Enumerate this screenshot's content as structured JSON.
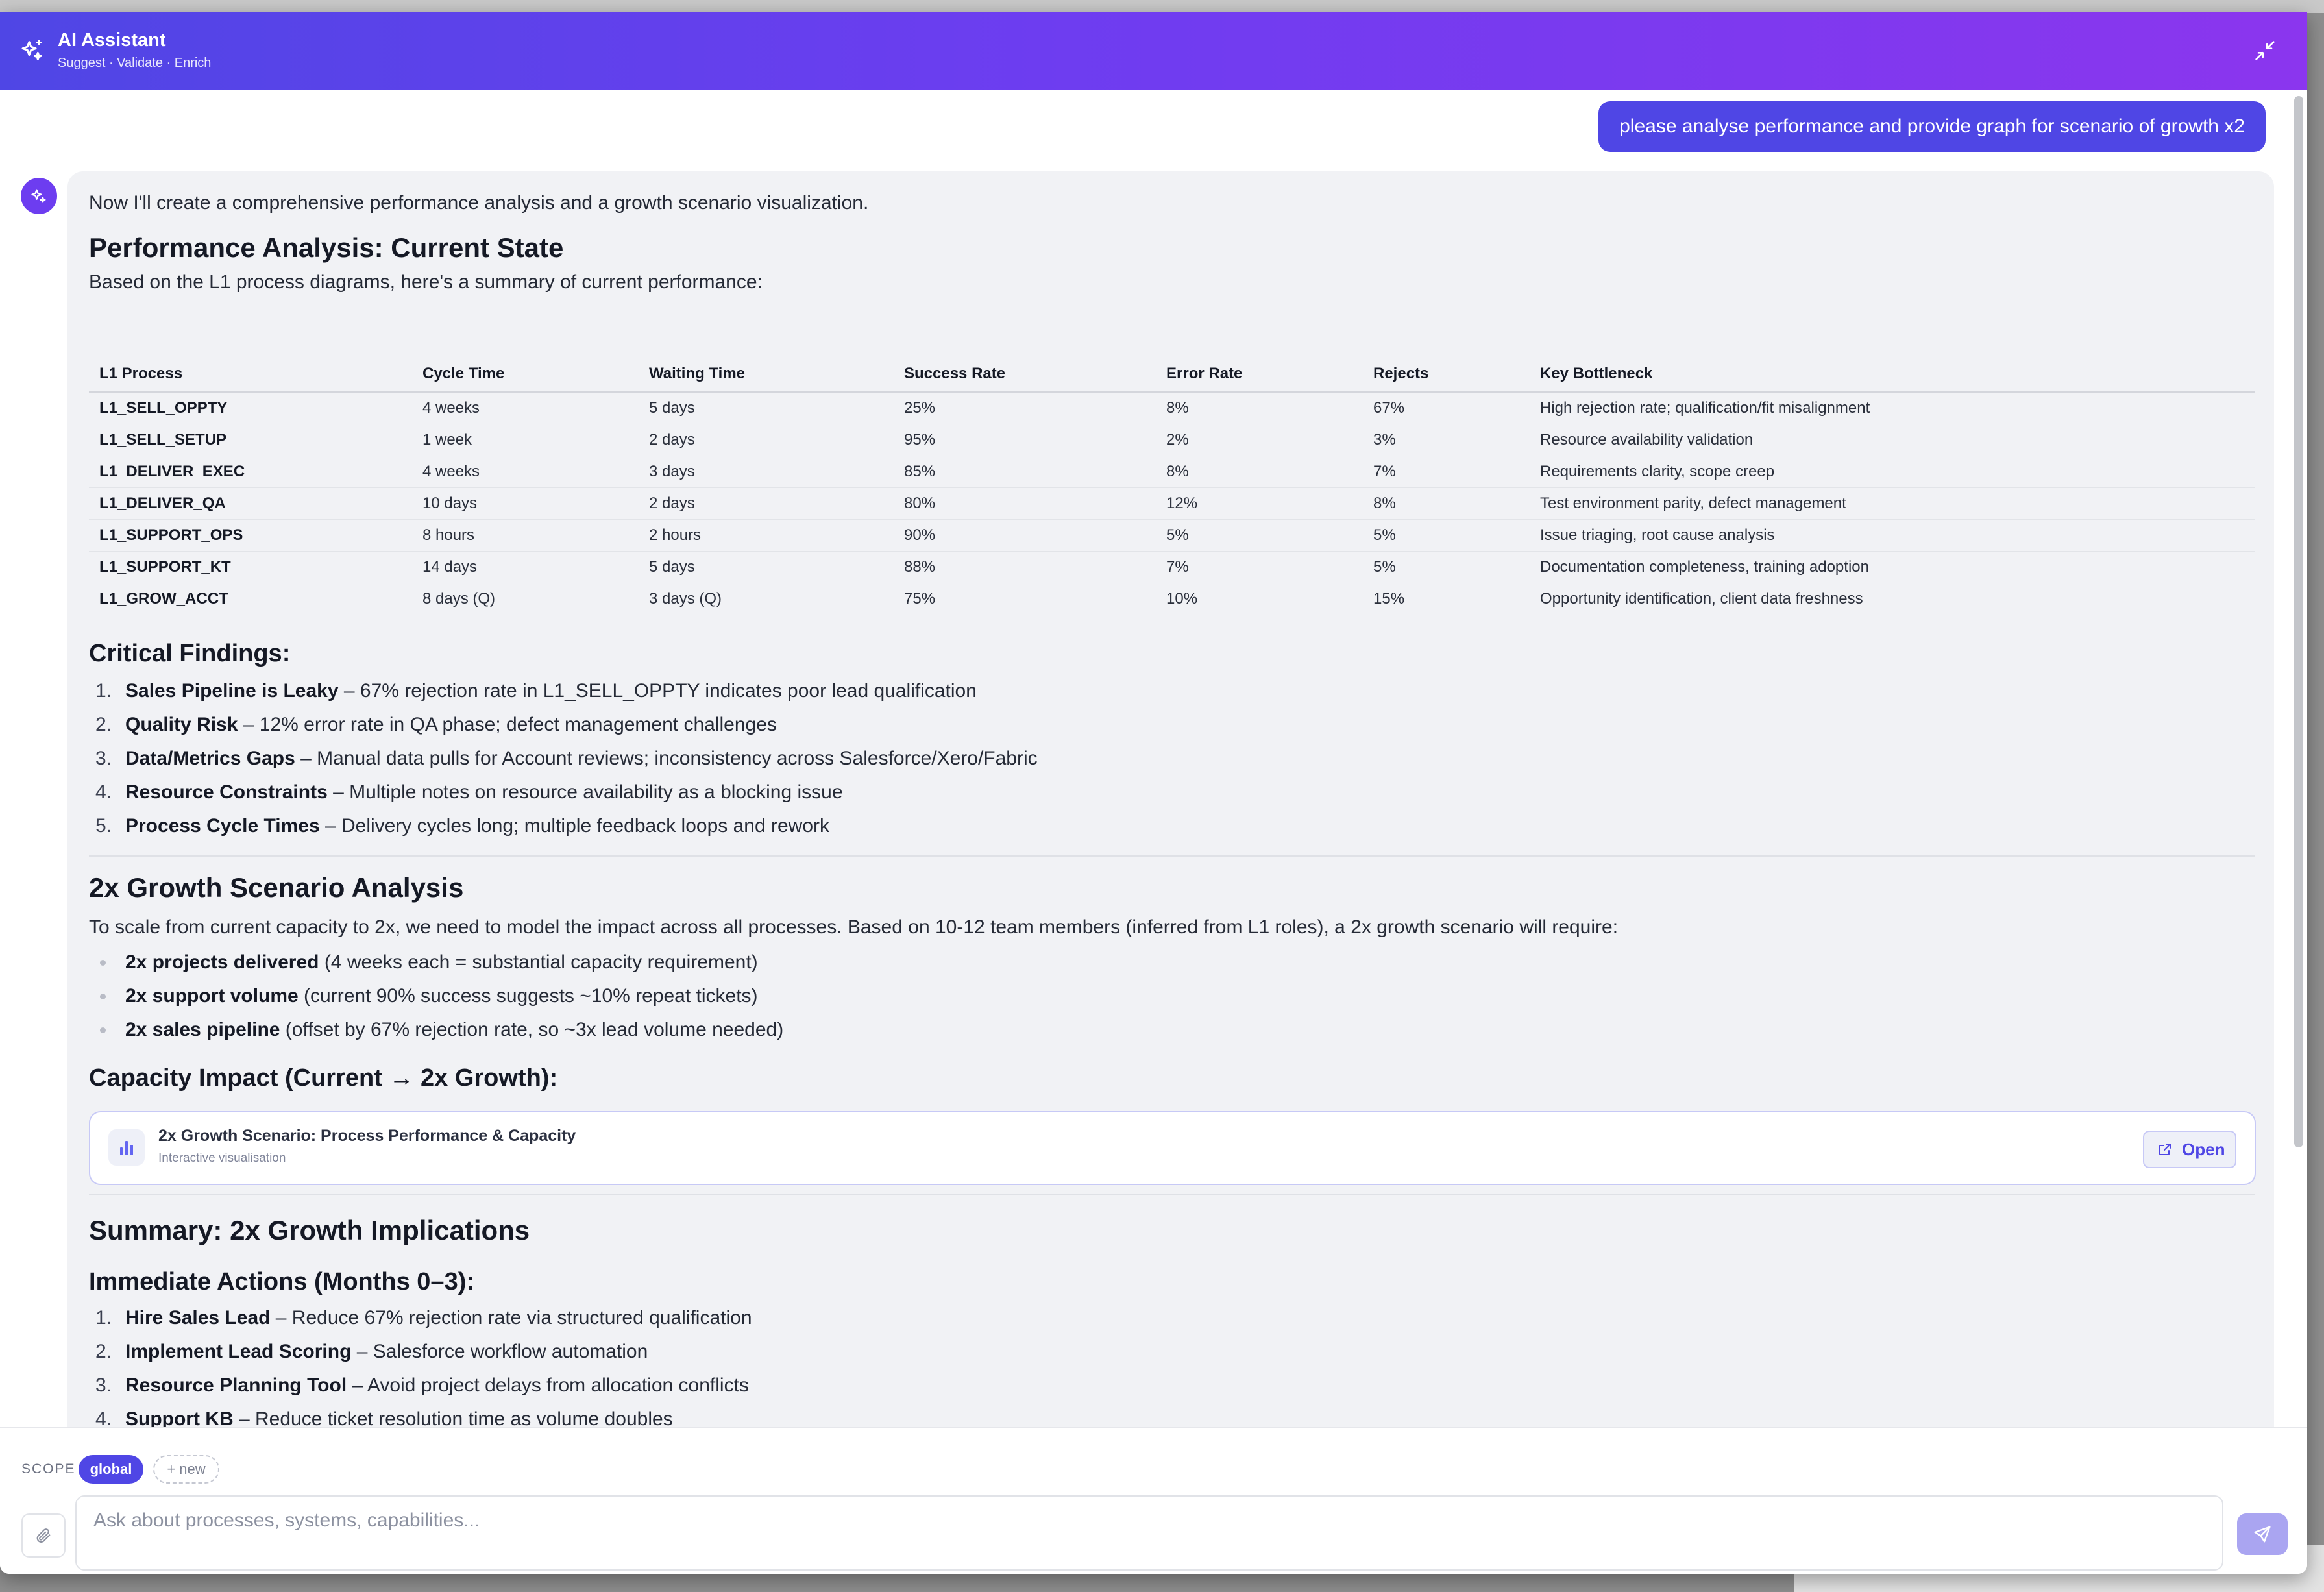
{
  "header": {
    "title": "AI Assistant",
    "subtitle": "Suggest · Validate · Enrich",
    "icon": "sparkles-icon",
    "minimize_icon": "collapse-icon"
  },
  "messages": {
    "user": "please analyse performance and provide graph for scenario of growth x2",
    "assistant": {
      "intro": "Now I'll create a comprehensive performance analysis and a growth scenario visualization.",
      "h_performance": "Performance Analysis: Current State",
      "performance_intro": "Based on the L1 process diagrams, here's a summary of current performance:",
      "table": {
        "headers": [
          "L1 Process",
          "Cycle Time",
          "Waiting Time",
          "Success Rate",
          "Error Rate",
          "Rejects",
          "Key Bottleneck"
        ],
        "rows": [
          [
            "L1_SELL_OPPTY",
            "4 weeks",
            "5 days",
            "25%",
            "8%",
            "67%",
            "High rejection rate; qualification/fit misalignment"
          ],
          [
            "L1_SELL_SETUP",
            "1 week",
            "2 days",
            "95%",
            "2%",
            "3%",
            "Resource availability validation"
          ],
          [
            "L1_DELIVER_EXEC",
            "4 weeks",
            "3 days",
            "85%",
            "8%",
            "7%",
            "Requirements clarity, scope creep"
          ],
          [
            "L1_DELIVER_QA",
            "10 days",
            "2 days",
            "80%",
            "12%",
            "8%",
            "Test environment parity, defect management"
          ],
          [
            "L1_SUPPORT_OPS",
            "8 hours",
            "2 hours",
            "90%",
            "5%",
            "5%",
            "Issue triaging, root cause analysis"
          ],
          [
            "L1_SUPPORT_KT",
            "14 days",
            "5 days",
            "88%",
            "7%",
            "5%",
            "Documentation completeness, training adoption"
          ],
          [
            "L1_GROW_ACCT",
            "8 days (Q)",
            "3 days (Q)",
            "75%",
            "10%",
            "15%",
            "Opportunity identification, client data freshness"
          ]
        ]
      },
      "h_findings": "Critical Findings:",
      "findings": [
        {
          "num": "1.",
          "bold": "Sales Pipeline is Leaky",
          "text": " – 67% rejection rate in L1_SELL_OPPTY indicates poor lead qualification"
        },
        {
          "num": "2.",
          "bold": "Quality Risk",
          "text": " – 12% error rate in QA phase; defect management challenges"
        },
        {
          "num": "3.",
          "bold": "Data/Metrics Gaps",
          "text": " – Manual data pulls for Account reviews; inconsistency across Salesforce/Xero/Fabric"
        },
        {
          "num": "4.",
          "bold": "Resource Constraints",
          "text": " – Multiple notes on resource availability as a blocking issue"
        },
        {
          "num": "5.",
          "bold": "Process Cycle Times",
          "text": " – Delivery cycles long; multiple feedback loops and rework"
        }
      ],
      "h_growth": "2x Growth Scenario Analysis",
      "growth_intro": "To scale from current capacity to 2x, we need to model the impact across all processes. Based on 10-12 team members (inferred from L1 roles), a 2x growth scenario will require:",
      "growth_items": [
        {
          "bold": "2x projects delivered",
          "text": " (4 weeks each = substantial capacity requirement)"
        },
        {
          "bold": "2x support volume",
          "text": " (current 90% success suggests ~10% repeat tickets)"
        },
        {
          "bold": "2x sales pipeline",
          "text": " (offset by 67% rejection rate, so ~3x lead volume needed)"
        }
      ],
      "h_capacity": "Capacity Impact (Current → 2x Growth):",
      "card": {
        "title": "2x Growth Scenario: Process Performance & Capacity",
        "subtitle": "Interactive visualisation",
        "open_label": "Open",
        "icon": "bar-chart-icon"
      },
      "h_summary": "Summary: 2x Growth Implications",
      "h_actions": "Immediate Actions (Months 0–3):",
      "actions": [
        {
          "num": "1.",
          "bold": "Hire Sales Lead",
          "text": " – Reduce 67% rejection rate via structured qualification"
        },
        {
          "num": "2.",
          "bold": "Implement Lead Scoring",
          "text": " – Salesforce workflow automation"
        },
        {
          "num": "3.",
          "bold": "Resource Planning Tool",
          "text": " – Avoid project delays from allocation conflicts"
        },
        {
          "num": "4.",
          "bold": "Support KB",
          "text": " – Reduce ticket resolution time as volume doubles"
        }
      ]
    }
  },
  "footer": {
    "scope_label": "SCOPE",
    "scope_active": "global",
    "scope_new": "+ new",
    "input_placeholder": "Ask about processes, systems, capabilities...",
    "attach_icon": "paperclip-icon",
    "send_icon": "send-icon"
  },
  "colors": {
    "accent": "#4f46e5",
    "header_gradient_end": "#8b36ee",
    "assistant_bg": "#f1f2f5"
  }
}
